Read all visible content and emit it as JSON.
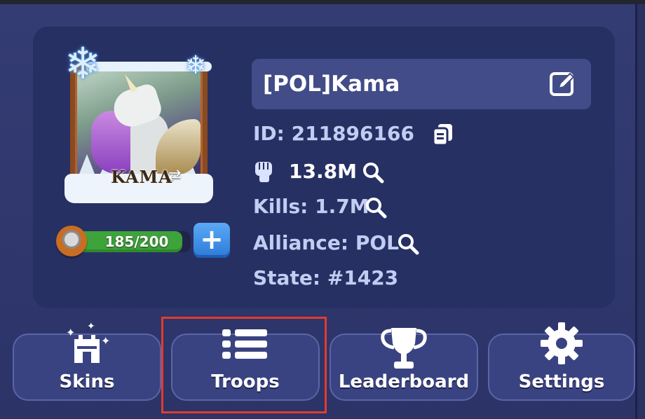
{
  "player": {
    "name": "[POL]Kama",
    "avatar_caption": "KAMA",
    "id_text": "ID: 211896166",
    "power": "13.8M",
    "kills_text": "Kills: 1.7M",
    "alliance_text": "Alliance: POL",
    "state_text": "State: #1423"
  },
  "stamina": {
    "text": "185/200",
    "fraction": 0.925,
    "add_label": "+"
  },
  "buttons": {
    "skins": "Skins",
    "troops": "Troops",
    "leaderboard": "Leaderboard",
    "settings": "Settings"
  },
  "icons": {
    "avatar_frame": "snowflake-frame",
    "edit": "edit-pencil-icon",
    "copy": "copy-icon",
    "power": "fist-icon",
    "search": "magnifier-icon",
    "skins": "castle-icon",
    "troops": "list-icon",
    "leaderboard": "trophy-icon",
    "settings": "gear-icon"
  },
  "colors": {
    "background": "#2a3163",
    "card": "#273063",
    "name_box": "#424c88",
    "stamina_fill": "#3fa33b",
    "add_button": "#3d8ee8",
    "highlight": "#e23b2e"
  }
}
